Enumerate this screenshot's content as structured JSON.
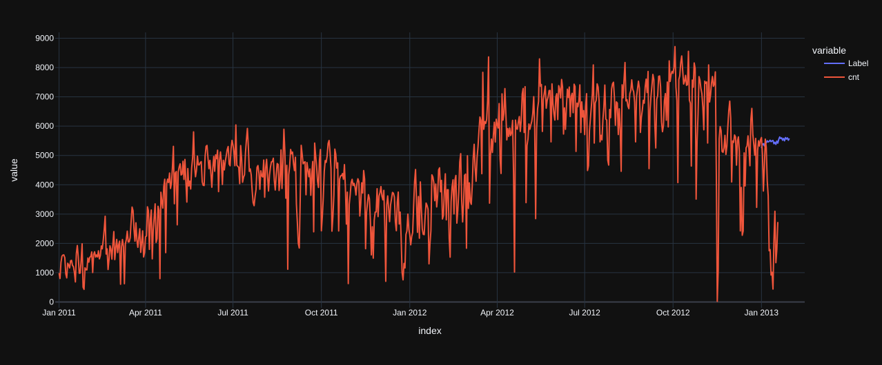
{
  "chart_data": {
    "type": "line",
    "xlabel": "index",
    "ylabel": "value",
    "legend": {
      "title": "variable",
      "placement": "top-right"
    },
    "x_range": [
      "2010-12-28",
      "2013-02-15"
    ],
    "ylim": [
      -200,
      9200
    ],
    "y_ticks": [
      0,
      1000,
      2000,
      3000,
      4000,
      5000,
      6000,
      7000,
      8000,
      9000
    ],
    "y_tick_labels": [
      "0",
      "1000",
      "2000",
      "3000",
      "4000",
      "5000",
      "6000",
      "7000",
      "8000",
      "9000"
    ],
    "x_ticks": [
      "2011-01-01",
      "2011-04-01",
      "2011-07-01",
      "2011-10-01",
      "2012-01-01",
      "2012-04-01",
      "2012-07-01",
      "2012-10-01",
      "2013-01-01"
    ],
    "x_tick_labels": [
      "Jan 2011",
      "Apr 2011",
      "Jul 2011",
      "Oct 2011",
      "Jan 2012",
      "Apr 2012",
      "Jul 2012",
      "Oct 2012",
      "Jan 2013"
    ],
    "grid": true,
    "series": [
      {
        "name": "Label",
        "color": "#636efa",
        "x_start": "2013-01-01",
        "values": [
          5250,
          5380,
          5400,
          5330,
          5450,
          5430,
          5500,
          5460,
          5480,
          5520,
          5470,
          5500,
          5510,
          5400,
          5450,
          5380,
          5490,
          5420,
          5550,
          5630,
          5580,
          5600,
          5520,
          5580,
          5500,
          5610,
          5560,
          5600,
          5520,
          5580
        ]
      },
      {
        "name": "cnt",
        "color": "#EF553B",
        "x_start": "2011-01-01",
        "values": [
          985,
          801,
          1349,
          1562,
          1600,
          1606,
          1510,
          959,
          822,
          1321,
          1263,
          1162,
          1406,
          1421,
          1248,
          1204,
          1000,
          683,
          1650,
          1927,
          1543,
          981,
          986,
          1416,
          1985,
          506,
          431,
          1167,
          1098,
          1096,
          1501,
          1360,
          1526,
          1550,
          1708,
          1005,
          1623,
          1712,
          1530,
          1605,
          1538,
          1746,
          1472,
          1589,
          1913,
          1815,
          2115,
          2475,
          2927,
          1635,
          1812,
          1107,
          1450,
          1917,
          1807,
          1461,
          1969,
          2402,
          1446,
          1851,
          2134,
          1685,
          1944,
          2077,
          605,
          1872,
          2133,
          1891,
          623,
          1977,
          2132,
          2417,
          2046,
          2056,
          2192,
          2744,
          3239,
          3117,
          2471,
          2077,
          2703,
          2121,
          1865,
          2210,
          2496,
          1693,
          2028,
          2425,
          1536,
          1685,
          2227,
          2252,
          3249,
          3115,
          1795,
          2808,
          3141,
          1471,
          2455,
          2895,
          3348,
          2034,
          2162,
          3267,
          3126,
          795,
          3744,
          3429,
          3204,
          3944,
          4189,
          1683,
          4036,
          4191,
          4073,
          4400,
          3872,
          4058,
          4595,
          5312,
          3351,
          4401,
          4451,
          2633,
          4433,
          4608,
          4714,
          4333,
          4362,
          4803,
          4182,
          4864,
          4105,
          3409,
          4553,
          3958,
          4123,
          3855,
          4575,
          4917,
          5805,
          4660,
          4274,
          4492,
          4978,
          4677,
          4679,
          4758,
          4788,
          4098,
          3982,
          3974,
          4968,
          5312,
          5342,
          4906,
          4548,
          4833,
          4401,
          3915,
          4586,
          4966,
          4460,
          5020,
          4891,
          5180,
          3767,
          4844,
          5119,
          4744,
          4010,
          4835,
          4507,
          4790,
          4991,
          5202,
          5305,
          4708,
          4648,
          5225,
          5515,
          5362,
          5119,
          4649,
          6043,
          4665,
          4629,
          4592,
          4040,
          5336,
          4881,
          4086,
          4258,
          4342,
          5084,
          5538,
          5923,
          5302,
          4458,
          4541,
          4332,
          3784,
          3387,
          3285,
          3606,
          3840,
          4590,
          4656,
          4390,
          3846,
          4475,
          4302,
          4266,
          4845,
          3574,
          4576,
          4866,
          4294,
          3785,
          4326,
          4602,
          4780,
          4792,
          4905,
          4150,
          3820,
          4338,
          4725,
          4694,
          3805,
          4153,
          5191,
          3873,
          4758,
          5895,
          5130,
          3542,
          4661,
          1115,
          4334,
          4634,
          5204,
          5058,
          5115,
          4727,
          4484,
          4940,
          3351,
          2710,
          1996,
          1842,
          3544,
          5345,
          5046,
          4713,
          4763,
          4785,
          3659,
          4760,
          4511,
          4274,
          4539,
          3641,
          4352,
          4795,
          2395,
          5423,
          5010,
          4630,
          4120,
          3907,
          4839,
          5202,
          2429,
          2918,
          3570,
          4456,
          4826,
          4765,
          4985,
          5409,
          5511,
          5117,
          4563,
          2416,
          2913,
          3644,
          5217,
          5041,
          4570,
          4748,
          2424,
          4195,
          4304,
          4308,
          4381,
          4187,
          4687,
          3894,
          2659,
          3747,
          627,
          3331,
          3669,
          4068,
          4186,
          3974,
          4046,
          3926,
          3649,
          4035,
          4205,
          4109,
          2933,
          3368,
          4067,
          3717,
          4486,
          4195,
          1817,
          3053,
          3392,
          3663,
          3520,
          2765,
          1607,
          2566,
          1495,
          2792,
          3068,
          3071,
          3867,
          2914,
          3613,
          3727,
          3940,
          3614,
          3485,
          3811,
          2594,
          705,
          3322,
          3620,
          3190,
          2743,
          3310,
          3523,
          3740,
          3709,
          3577,
          2739,
          2431,
          3403,
          3750,
          2660,
          3068,
          2209,
          1011,
          754,
          1317,
          1162,
          2302,
          2423,
          2999,
          2485,
          2294,
          1951,
          2236,
          2368,
          3272,
          4098,
          4521,
          3425,
          2376,
          3598,
          2177,
          4097,
          3214,
          2493,
          2311,
          2298,
          2935,
          3376,
          3292,
          3163,
          1301,
          1977,
          2432,
          4339,
          4270,
          4075,
          3456,
          4023,
          3243,
          3624,
          4509,
          4579,
          3761,
          4151,
          2832,
          2947,
          3784,
          4375,
          2802,
          3830,
          3831,
          2169,
          1529,
          3422,
          3922,
          4169,
          3005,
          4154,
          4318,
          2689,
          3129,
          3777,
          4773,
          5062,
          3487,
          2732,
          3389,
          4322,
          4363,
          1834,
          4990,
          3194,
          4066,
          3423,
          3333,
          3956,
          4916,
          5382,
          4569,
          4118,
          4911,
          5298,
          5847,
          6312,
          6192,
          4378,
          7836,
          5892,
          6153,
          6093,
          6230,
          6871,
          8362,
          3372,
          4996,
          5558,
          5102,
          5698,
          6133,
          5459,
          6235,
          6041,
          5936,
          6772,
          4879,
          4385,
          7102,
          6203,
          6436,
          7283,
          6436,
          5530,
          5918,
          5648,
          5939,
          5680,
          5778,
          6198,
          4359,
          1023,
          6208,
          5911,
          5897,
          6147,
          6328,
          5818,
          6191,
          7092,
          7285,
          5783,
          7346,
          3389,
          5342,
          5557,
          6073,
          5893,
          6041,
          6169,
          6435,
          7005,
          5917,
          2843,
          5913,
          6591,
          6843,
          8294,
          7359,
          7421,
          5819,
          6917,
          7134,
          7363,
          6612,
          6884,
          6998,
          7213,
          7218,
          5464,
          7443,
          6778,
          6429,
          6208,
          7000,
          7108,
          6226,
          7382,
          7264,
          6962,
          7592,
          7334,
          5732,
          6624,
          5891,
          6630,
          7261,
          6979,
          7335,
          6327,
          7013,
          7121,
          6460,
          7431,
          7351,
          5138,
          6786,
          6664,
          6873,
          7409,
          5785,
          6829,
          6312,
          6529,
          5712,
          6659,
          7110,
          4486,
          4648,
          5847,
          6262,
          6690,
          7112,
          8090,
          5423,
          6790,
          6884,
          7442,
          7335,
          6879,
          5463,
          5687,
          5531,
          6227,
          6660,
          7403,
          6241,
          6207,
          4840,
          4672,
          6569,
          6290,
          7264,
          7446,
          7499,
          6969,
          6031,
          6830,
          6786,
          5713,
          6591,
          5870,
          4459,
          7410,
          6966,
          7592,
          8173,
          6861,
          6904,
          6685,
          6597,
          7105,
          7216,
          7580,
          7261,
          7175,
          6824,
          5464,
          7013,
          7273,
          7534,
          7286,
          5786,
          6299,
          6544,
          6883,
          6784,
          7347,
          7605,
          7148,
          7865,
          4549,
          6530,
          7006,
          7375,
          7765,
          7582,
          6053,
          5255,
          6917,
          7040,
          7697,
          7713,
          7350,
          6140,
          5810,
          6034,
          6864,
          7112,
          6203,
          7504,
          5976,
          8227,
          7525,
          7767,
          7870,
          7804,
          8009,
          8714,
          7333,
          6869,
          4073,
          7591,
          7720,
          8167,
          8395,
          7907,
          7436,
          7538,
          7733,
          7393,
          7415,
          8555,
          6889,
          6778,
          4639,
          7572,
          7328,
          8156,
          7965,
          3510,
          5478,
          6392,
          7691,
          7570,
          7282,
          7109,
          6639,
          5875,
          7534,
          7461,
          7509,
          5424,
          8090,
          6824,
          7058,
          7466,
          7693,
          7359,
          7444,
          7852,
          4459,
          22,
          1096,
          5566,
          5986,
          5847,
          5138,
          5107,
          5259,
          5686,
          5035,
          5315,
          5992,
          6536,
          6852,
          6269,
          4094,
          5495,
          5445,
          5698,
          5629,
          4669,
          5499,
          5634,
          5146,
          2425,
          3910,
          2277,
          2424,
          5087,
          3959,
          5260,
          5323,
          5668,
          5191,
          4649,
          6234,
          6606,
          5729,
          5375,
          5008,
          5582,
          3228,
          5170,
          5501,
          5319,
          5532,
          5611,
          5047,
          3786,
          4585,
          5557,
          5267,
          4128,
          3623,
          1749,
          1787,
          920,
          1013,
          441,
          2114,
          3095,
          1341,
          1796,
          2729
        ]
      }
    ]
  }
}
